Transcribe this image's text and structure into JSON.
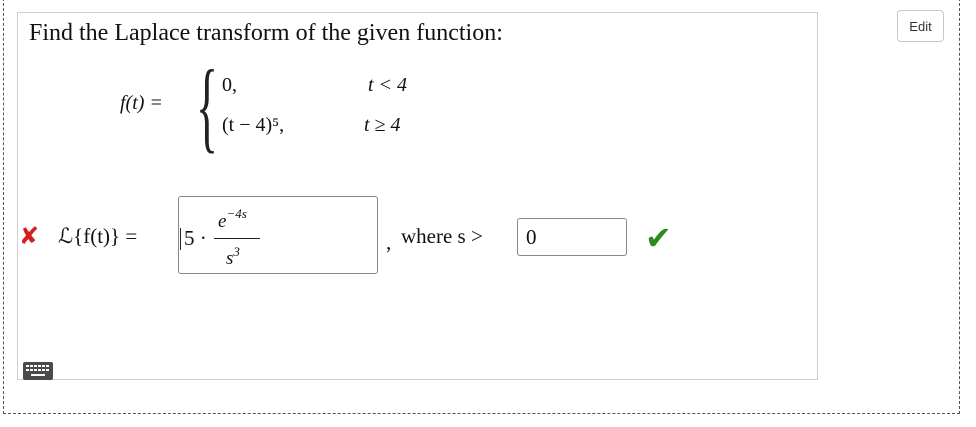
{
  "edit_button": {
    "label": "Edit"
  },
  "question": {
    "prompt": "Find the Laplace transform of the given function:",
    "f_lhs": "f(t) =",
    "cases": [
      {
        "expression": "0,",
        "condition": "t < 4"
      },
      {
        "expression": "(t − 4)⁵,",
        "condition": "t ≥ 4"
      }
    ]
  },
  "answer": {
    "status": "incorrect",
    "lhs": "ℒ{f(t)} =",
    "coefficient": "5 ·",
    "numerator_base": "e",
    "numerator_exponent": "−4s",
    "denominator_base": "s",
    "denominator_exponent": "3",
    "separator": ",",
    "where_label": "where s >",
    "s_bound_value": "0",
    "s_bound_status": "correct"
  },
  "icons": {
    "incorrect": "cross-icon",
    "correct": "checkmark-icon",
    "keyboard": "keyboard-icon"
  },
  "colors": {
    "incorrect": "#d42020",
    "correct": "#2f8a1d"
  }
}
